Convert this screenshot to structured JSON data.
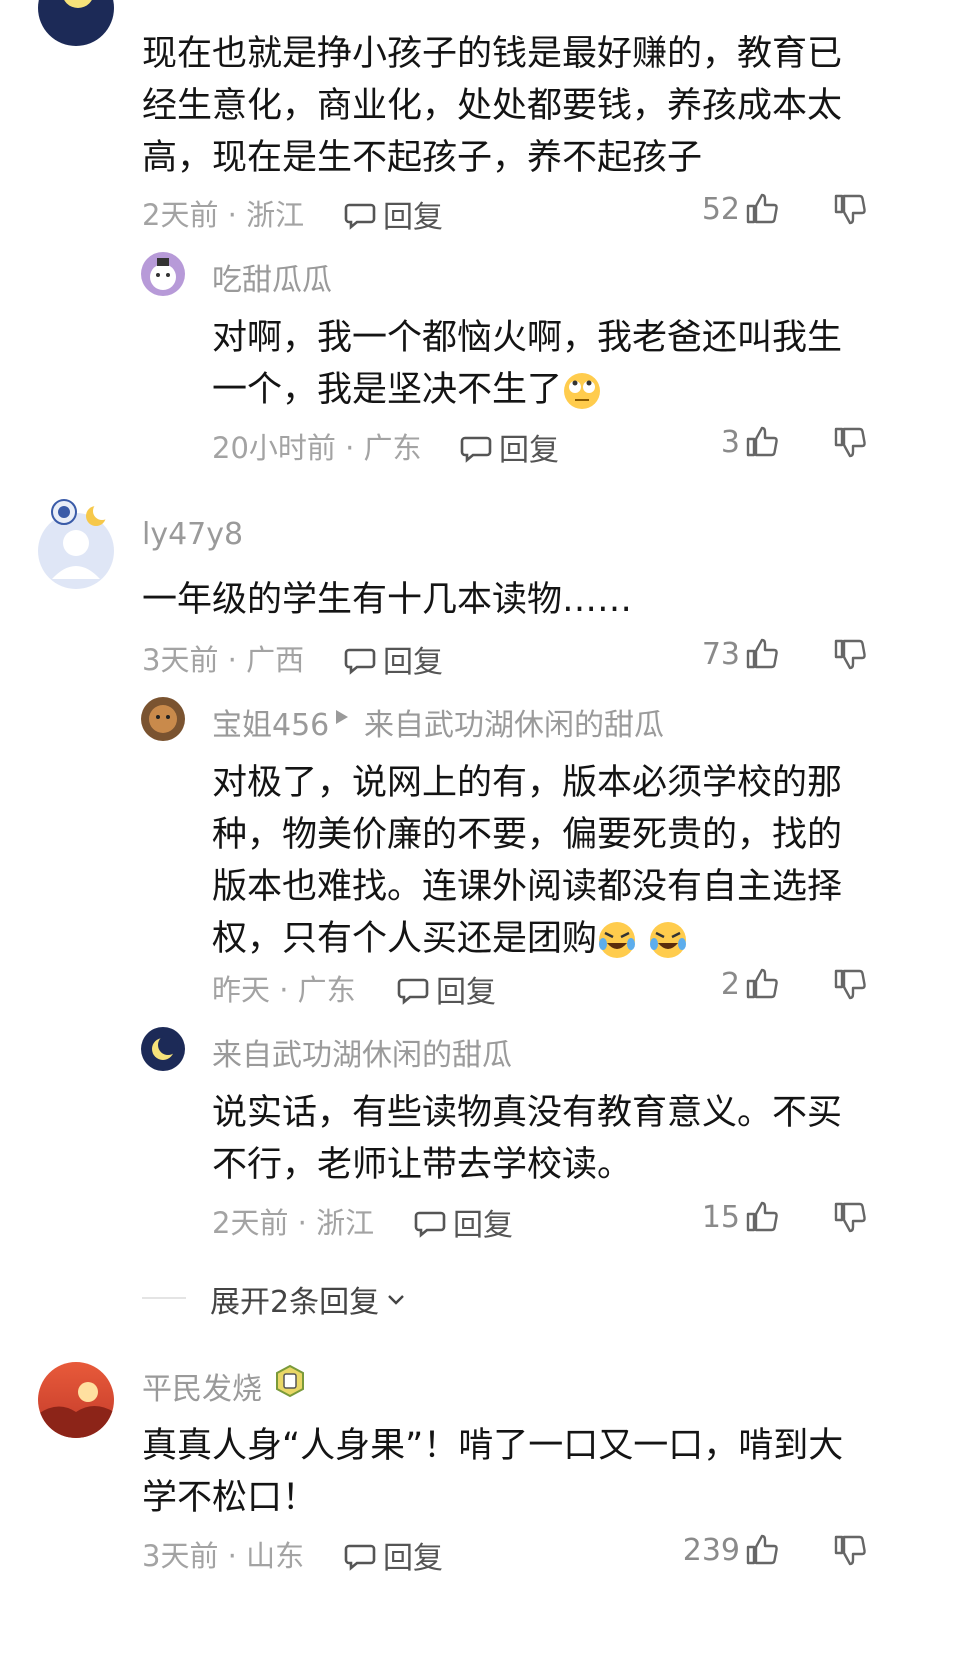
{
  "comments": [
    {
      "text": "现在也就是挣小孩子的钱是最好赚的，教育已经生意化，商业化，处处都要钱，养孩成本太高，现在是生不起孩子，养不起孩子",
      "meta": "2天前 · 浙江",
      "reply_label": "回复",
      "likes": "52"
    },
    {
      "username": "吃甜瓜瓜",
      "text": "对啊，我一个都恼火啊，我老爸还叫我生一个，我是坚决不生了",
      "meta": "20小时前 · 广东",
      "reply_label": "回复",
      "likes": "3"
    },
    {
      "username": "ly47y8",
      "text": "一年级的学生有十几本读物……",
      "meta": "3天前 · 广西",
      "reply_label": "回复",
      "likes": "73"
    },
    {
      "username": "宝姐456",
      "reply_to": "来自武功湖休闲的甜瓜",
      "text": "对极了，说网上的有，版本必须学校的那种，物美价廉的不要，偏要死贵的，找的版本也难找。连课外阅读都没有自主选择权，只有个人买还是团购",
      "meta": "昨天 · 广东",
      "reply_label": "回复",
      "likes": "2"
    },
    {
      "username": "来自武功湖休闲的甜瓜",
      "text": "说实话，有些读物真没有教育意义。不买不行，老师让带去学校读。",
      "meta": "2天前 · 浙江",
      "reply_label": "回复",
      "likes": "15"
    },
    {
      "username": "平民发烧",
      "text": "真真人身“人身果”！啃了一口又一口，啃到大学不松口！",
      "meta": "3天前 · 山东",
      "reply_label": "回复",
      "likes": "239"
    }
  ],
  "expand_label": "展开2条回复",
  "icons": {
    "reply": "comment-bubble-icon",
    "like": "thumbs-up-icon",
    "dislike": "thumbs-down-icon",
    "expand": "chevron-down-icon",
    "reply_arrow": "triangle-right-icon",
    "badge": "level-badge-icon"
  },
  "colors": {
    "muted": "#a3a3a3",
    "text": "#141414",
    "accent": "#f5a623"
  }
}
